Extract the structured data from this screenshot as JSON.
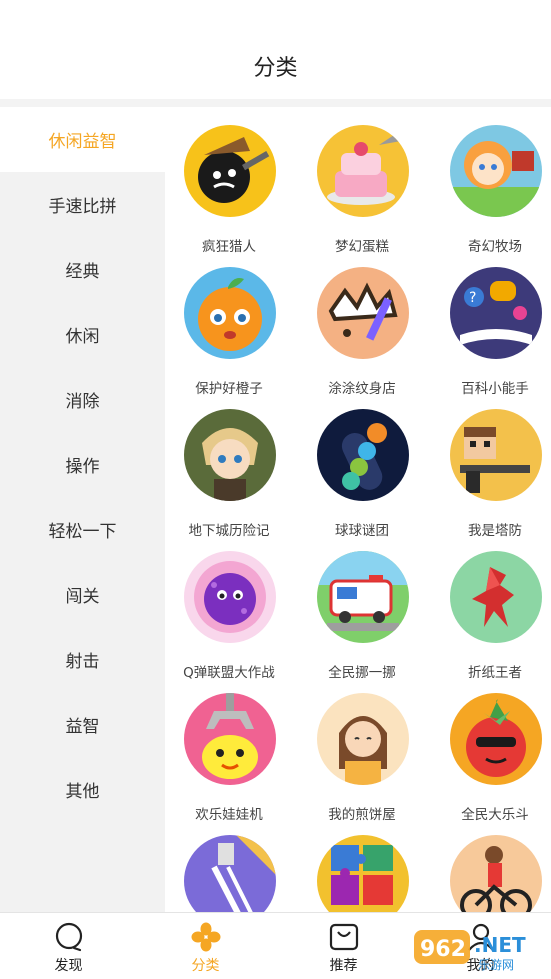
{
  "header": {
    "title": "分类"
  },
  "sidebar": {
    "items": [
      {
        "label": "休闲益智",
        "active": true
      },
      {
        "label": "手速比拼"
      },
      {
        "label": "经典"
      },
      {
        "label": "休闲"
      },
      {
        "label": "消除"
      },
      {
        "label": "操作"
      },
      {
        "label": "轻松一下"
      },
      {
        "label": "闯关"
      },
      {
        "label": "射击"
      },
      {
        "label": "益智"
      },
      {
        "label": "其他"
      }
    ]
  },
  "games": [
    {
      "name": "疯狂猎人",
      "icon": "hunter-game-icon"
    },
    {
      "name": "梦幻蛋糕",
      "icon": "cake-game-icon"
    },
    {
      "name": "奇幻牧场",
      "icon": "ranch-game-icon"
    },
    {
      "name": "保护好橙子",
      "icon": "orange-game-icon"
    },
    {
      "name": "涂涂纹身店",
      "icon": "tattoo-game-icon"
    },
    {
      "name": "百科小能手",
      "icon": "encyclopedia-game-icon"
    },
    {
      "name": "地下城历险记",
      "icon": "dungeon-game-icon"
    },
    {
      "name": "球球谜团",
      "icon": "ball-sort-game-icon"
    },
    {
      "name": "我是塔防",
      "icon": "tower-defense-game-icon"
    },
    {
      "name": "Q弹联盟大作战",
      "icon": "bouncy-game-icon"
    },
    {
      "name": "全民挪一挪",
      "icon": "ambulance-game-icon"
    },
    {
      "name": "折纸王者",
      "icon": "origami-game-icon"
    },
    {
      "name": "欢乐娃娃机",
      "icon": "claw-machine-game-icon"
    },
    {
      "name": "我的煎饼屋",
      "icon": "pancake-game-icon"
    },
    {
      "name": "全民大乐斗",
      "icon": "fight-game-icon"
    },
    {
      "name": "",
      "icon": "shower-game-icon"
    },
    {
      "name": "",
      "icon": "puzzle-game-icon"
    },
    {
      "name": "",
      "icon": "bike-game-icon"
    }
  ],
  "tabbar": {
    "tabs": [
      {
        "label": "发现",
        "icon": "discover-icon"
      },
      {
        "label": "分类",
        "icon": "category-icon",
        "active": true
      },
      {
        "label": "推荐",
        "icon": "recommend-bag-icon"
      },
      {
        "label": "我的",
        "icon": "profile-icon"
      }
    ]
  },
  "watermark": {
    "text": "962.NET",
    "subtext": "乐游网"
  },
  "colors": {
    "accent": "#f5a623",
    "sidebar_bg": "#f2f2f2"
  }
}
